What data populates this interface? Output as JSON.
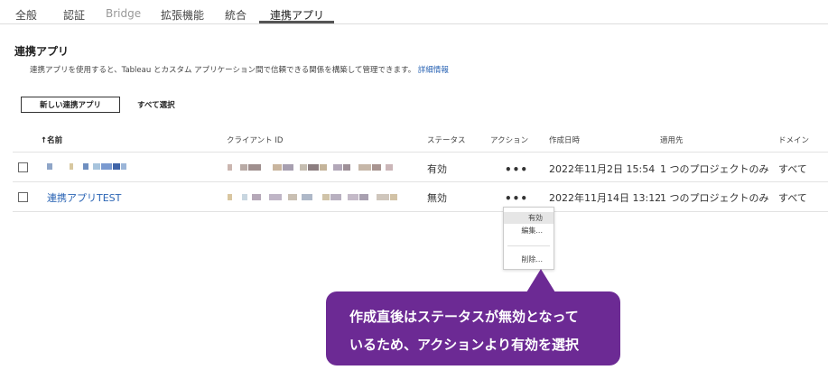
{
  "tabs": [
    {
      "label": "全般"
    },
    {
      "label": "認証"
    },
    {
      "label": "Bridge"
    },
    {
      "label": "拡張機能"
    },
    {
      "label": "統合"
    },
    {
      "label": "連携アプリ"
    }
  ],
  "page": {
    "title": "連携アプリ",
    "description": "連携アプリを使用すると、Tableau とカスタム アプリケーション間で信頼できる関係を構築して管理できます。",
    "details_link": "詳細情報"
  },
  "toolbar": {
    "new_button": "新しい連携アプリ",
    "select_all": "すべて選択"
  },
  "table": {
    "columns": {
      "name": "↑名前",
      "client_id": "クライアント ID",
      "status": "ステータス",
      "action": "アクション",
      "created": "作成日時",
      "scope": "適用先",
      "domain": "ドメイン"
    },
    "rows": [
      {
        "name": "",
        "status": "有効",
        "action": "•••",
        "created": "2022年11月2日 15:54",
        "scope": "1 つのプロジェクトのみ",
        "domain": "すべて"
      },
      {
        "name": "連携アプリTEST",
        "status": "無効",
        "action": "•••",
        "created": "2022年11月14日 13:12",
        "scope": "1 つのプロジェクトのみ",
        "domain": "すべて"
      }
    ]
  },
  "menu": {
    "items": [
      "有効",
      "編集...",
      "削除..."
    ]
  },
  "callout": {
    "line1": "作成直後はステータスが無効となって",
    "line2": "いるため、アクションより有効を選択"
  },
  "colors": {
    "accent": "#6c2a94",
    "link": "#2a64b4"
  }
}
